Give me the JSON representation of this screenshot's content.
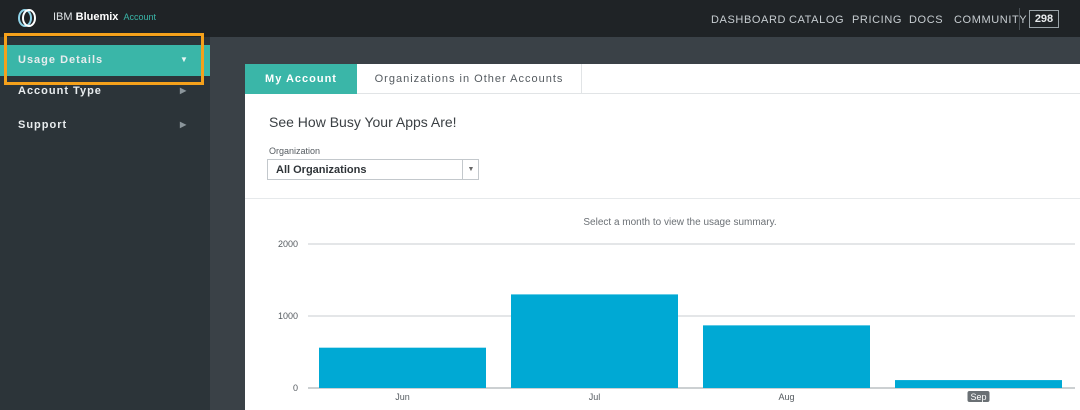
{
  "topbar": {
    "brand_prefix": "IBM ",
    "brand_name": "Bluemix",
    "brand_suffix": "Account",
    "nav": [
      "DASHBOARD",
      "CATALOG",
      "PRICING",
      "DOCS",
      "COMMUNITY"
    ],
    "notification_count": "298"
  },
  "sidebar": {
    "items": [
      {
        "label": "Usage Details",
        "active": true,
        "icon": "chevron-down-icon"
      },
      {
        "label": "Account Type",
        "active": false,
        "icon": "chevron-right-icon"
      },
      {
        "label": "Support",
        "active": false,
        "icon": "chevron-right-icon"
      }
    ]
  },
  "tabs": {
    "my_account": "My Account",
    "other_orgs": "Organizations in Other Accounts"
  },
  "main": {
    "heading": "See How Busy Your Apps Are!",
    "org_label": "Organization",
    "org_select_value": "All Organizations",
    "chart_hint": "Select a month to view the usage summary."
  },
  "colors": {
    "accent": "#3ab6a8",
    "bar": "#00a9d4",
    "highlight": "#f5a11b"
  },
  "chart_data": {
    "type": "bar",
    "categories": [
      "Jun",
      "Jul",
      "Aug",
      "Sep"
    ],
    "values": [
      560,
      1300,
      870,
      110
    ],
    "ylim": [
      0,
      2000
    ],
    "yticks": [
      0,
      1000,
      2000
    ],
    "selected_category": "Sep",
    "grid": true
  }
}
